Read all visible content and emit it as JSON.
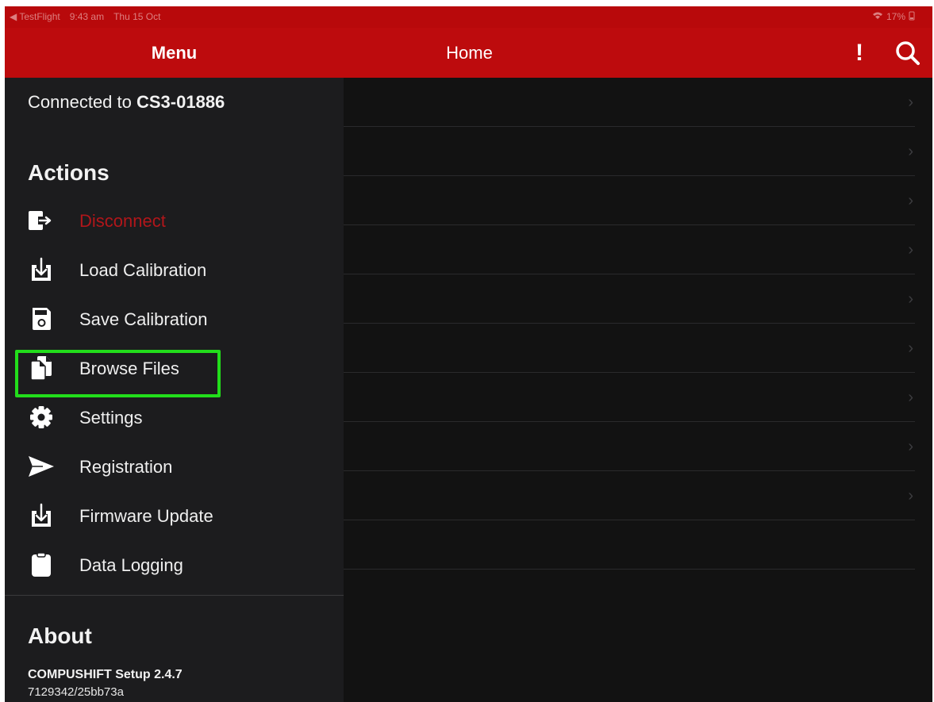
{
  "status_bar": {
    "left_items": [
      "◀ TestFlight",
      "9:43 am",
      "Thu 15 Oct"
    ],
    "right_items": [
      "17%"
    ]
  },
  "nav": {
    "menu_title": "Menu",
    "home_title": "Home",
    "alert_icon": "!",
    "search_icon": "search-icon"
  },
  "sidebar": {
    "connected_prefix": "Connected to ",
    "device_name": "CS3-01886",
    "actions_title": "Actions",
    "actions": [
      {
        "label": "Disconnect",
        "icon": "logout-icon"
      },
      {
        "label": "Load Calibration",
        "icon": "download-icon"
      },
      {
        "label": "Save Calibration",
        "icon": "save-icon"
      },
      {
        "label": "Browse Files",
        "icon": "files-icon"
      },
      {
        "label": "Settings",
        "icon": "gear-icon"
      },
      {
        "label": "Registration",
        "icon": "send-icon"
      },
      {
        "label": "Firmware Update",
        "icon": "download-icon"
      },
      {
        "label": "Data Logging",
        "icon": "clipboard-icon"
      }
    ],
    "about_title": "About",
    "app_name_version": "COMPUSHIFT Setup 2.4.7",
    "build": "7129342/25bb73a"
  },
  "main": {
    "row_count": 10,
    "chevron": "›"
  },
  "colors": {
    "brand_red": "#bd0b0d",
    "danger_red": "#b1161a",
    "highlight_green": "#22dd1b",
    "sidebar_bg": "#1c1c1e",
    "main_bg": "#121212"
  }
}
